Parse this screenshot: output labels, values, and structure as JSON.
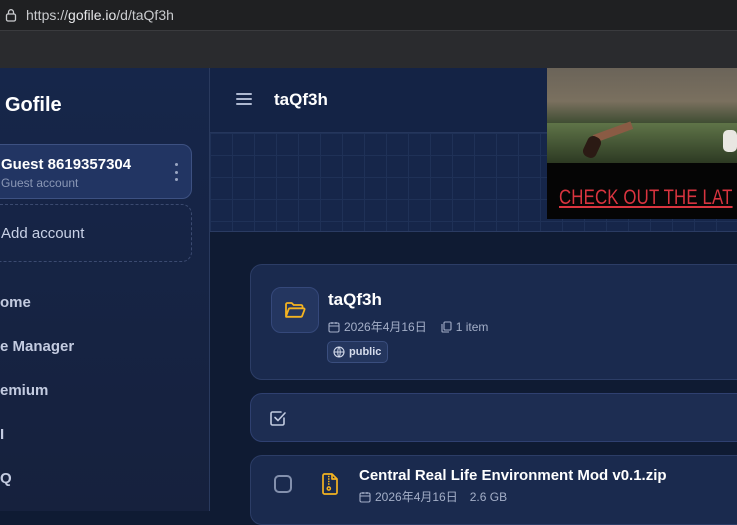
{
  "browser": {
    "url_prefix": "https://",
    "url_host": "gofile.io",
    "url_path": "/d/taQf3h"
  },
  "sidebar": {
    "brand": "Gofile",
    "account": {
      "name": "Guest 8619357304",
      "type": "Guest account"
    },
    "add_account": "Add account",
    "nav": [
      "ome",
      "e Manager",
      "emium",
      "I",
      "Q"
    ]
  },
  "header": {
    "title": "taQf3h"
  },
  "ad": {
    "cta": "CHECK OUT THE LAT"
  },
  "folder": {
    "name": "taQf3h",
    "date": "2026年4月16日",
    "items": "1 item",
    "visibility": "public"
  },
  "files": [
    {
      "name": "Central Real Life Environment Mod v0.1.zip",
      "date": "2026年4月16日",
      "size": "2.6 GB"
    }
  ],
  "colors": {
    "accent_folder": "#f4b321",
    "ad_text": "#d9343f",
    "background": "#0f1b33"
  },
  "icons": {
    "folder": "folder-open-icon",
    "calendar": "calendar-icon",
    "items": "copy-icon",
    "visibility": "globe-icon",
    "select_all": "square-check-icon",
    "file": "file-zip-icon",
    "menu": "hamburger-icon",
    "secure": "lock-icon"
  }
}
